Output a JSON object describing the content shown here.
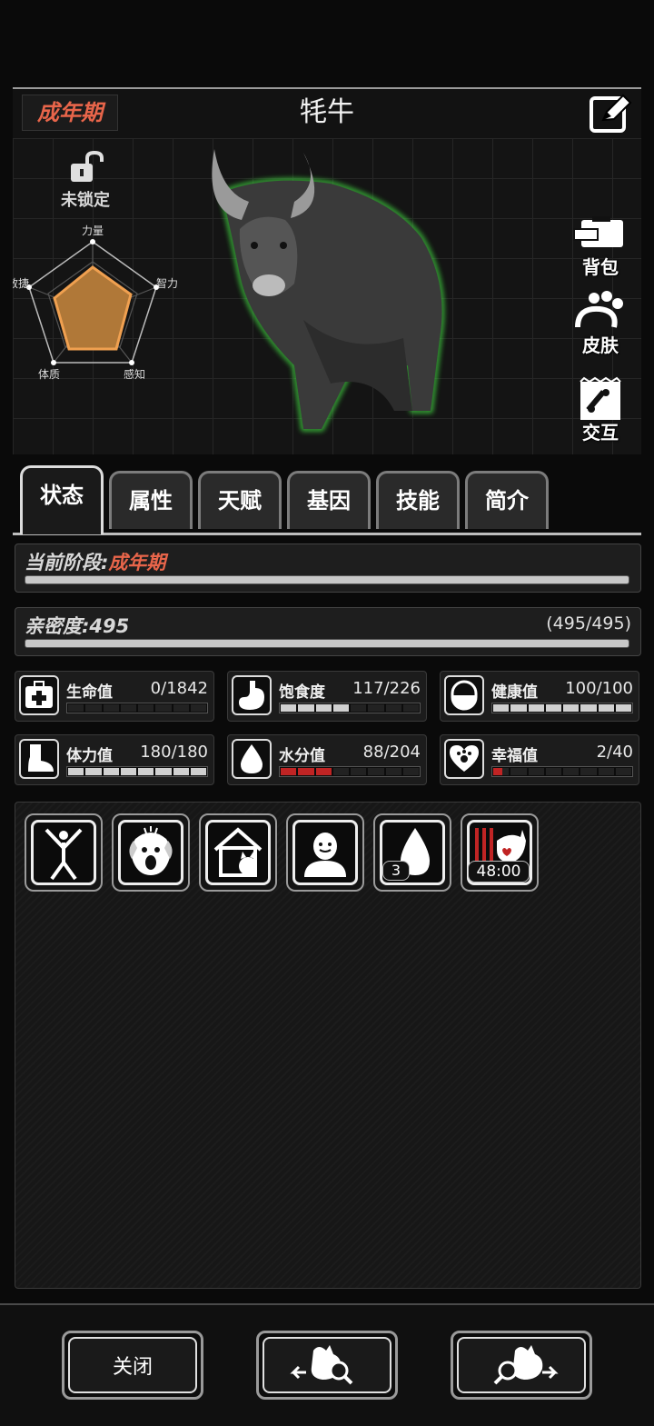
{
  "header": {
    "stage": "成年期",
    "animal_name": "牦牛"
  },
  "lock": {
    "label": "未锁定"
  },
  "radar": {
    "labels": {
      "strength": "力量",
      "intellect": "智力",
      "perception": "感知",
      "constitution": "体质",
      "agility": "敏捷"
    }
  },
  "side_buttons": {
    "backpack": "背包",
    "skin": "皮肤",
    "interact": "交互"
  },
  "tabs": [
    "状态",
    "属性",
    "天赋",
    "基因",
    "技能",
    "简介"
  ],
  "stage_panel": {
    "label": "当前阶段:",
    "value": "成年期",
    "progress": 1.0
  },
  "intimacy": {
    "label": "亲密度:",
    "value": "495",
    "ratio": "(495/495)",
    "progress": 1.0
  },
  "stats": {
    "hp": {
      "name": "生命值",
      "value": "0/1842",
      "fill": 0.0
    },
    "satiety": {
      "name": "饱食度",
      "value": "117/226",
      "fill": 0.52
    },
    "health": {
      "name": "健康值",
      "value": "100/100",
      "fill": 1.0
    },
    "stamina": {
      "name": "体力值",
      "value": "180/180",
      "fill": 1.0
    },
    "water": {
      "name": "水分值",
      "value": "88/204",
      "fill": 0.43
    },
    "happiness": {
      "name": "幸福值",
      "value": "2/40",
      "fill": 0.05
    }
  },
  "buffs": {
    "water_count": "3",
    "timer": "48:00"
  },
  "bottom": {
    "close": "关闭"
  },
  "colors": {
    "accent": "#e8654a",
    "radar_fill": "#f0a050",
    "bar_red": "#c02424",
    "glow": "#3fd03f"
  }
}
